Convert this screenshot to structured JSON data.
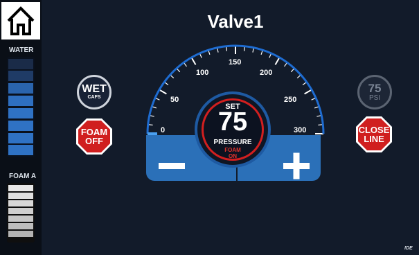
{
  "title": "Valve1",
  "sidebar": {
    "water_label": "WATER",
    "foam_label": "FOAM A"
  },
  "buttons": {
    "wet_main": "WET",
    "wet_sub": "CAFS",
    "foam_off": "FOAM OFF",
    "psi_value": "75",
    "psi_unit": "PSI",
    "close_line": "CLOSE LINE"
  },
  "gauge": {
    "set_label": "SET",
    "set_value": "75",
    "pressure_label": "PRESSURE",
    "foam_status": "FOAM ON",
    "tick_labels": [
      "0",
      "50",
      "100",
      "150",
      "200",
      "250",
      "300"
    ],
    "range": [
      0,
      300
    ],
    "current_value": 0
  },
  "colors": {
    "accent_blue": "#2b70b8",
    "alert_red": "#d21f1f",
    "background": "#121b2a"
  },
  "icons": {
    "home": "home-icon",
    "minus": "minus-icon",
    "plus": "plus-icon"
  }
}
